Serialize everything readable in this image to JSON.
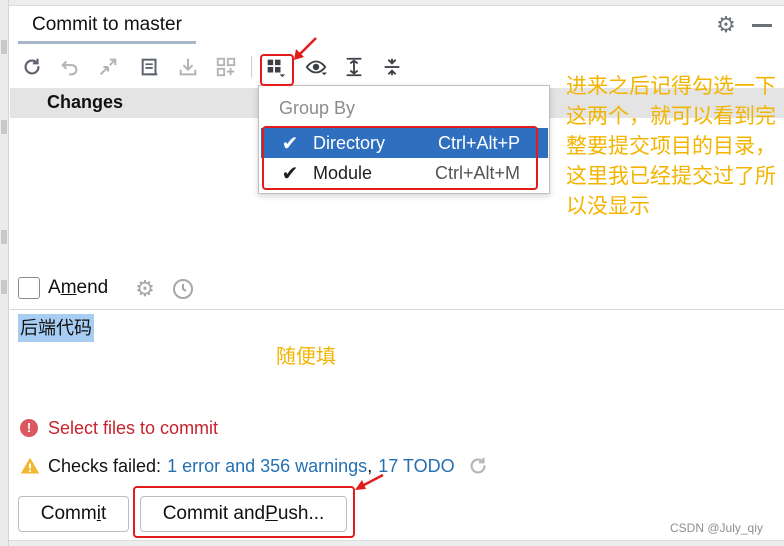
{
  "panel": {
    "tab_title": "Commit to master",
    "changes_label": "Changes"
  },
  "popup": {
    "title": "Group By",
    "items": [
      {
        "label": "Directory",
        "shortcut": "Ctrl+Alt+P",
        "checked": true,
        "selected": true
      },
      {
        "label": "Module",
        "shortcut": "Ctrl+Alt+M",
        "checked": true,
        "selected": false
      }
    ]
  },
  "amend": {
    "label_pre": "A",
    "label_underlined": "m",
    "label_post": "end",
    "checked": false
  },
  "message": {
    "text": "后端代码"
  },
  "status": {
    "error_text": "Select files to commit",
    "checks_prefix": "Checks failed:",
    "checks_link": "1 error and 356 warnings",
    "checks_sep": ",",
    "todo_link": "17 TODO"
  },
  "buttons": {
    "commit_pre": "Comm",
    "commit_underlined": "i",
    "commit_post": "t",
    "push_pre": "Commit and ",
    "push_underlined": "P",
    "push_post": "ush..."
  },
  "annotations": {
    "note": "进来之后记得勾选一下这两个，就可以看到完整要提交项目的目录，这里我已经提交过了所以没显示",
    "fill_hint": "随便填"
  },
  "watermark": "CSDN @July_qiy",
  "colors": {
    "accent": "#2f6fc0",
    "selection": "#a7cdf3",
    "error": "#c7222d",
    "link": "#2470b3",
    "annotation_red": "#e21b1b",
    "annotation_yellow": "#f3b400"
  },
  "icons": {
    "toolbar": [
      "refresh-icon",
      "undo-icon",
      "merge-arrows-icon",
      "diff-icon",
      "download-icon",
      "shelve-icon",
      "group-by-icon",
      "eye-icon",
      "expand-all-icon",
      "collapse-all-icon"
    ],
    "top_right": [
      "gear-icon",
      "minimize-icon"
    ]
  }
}
